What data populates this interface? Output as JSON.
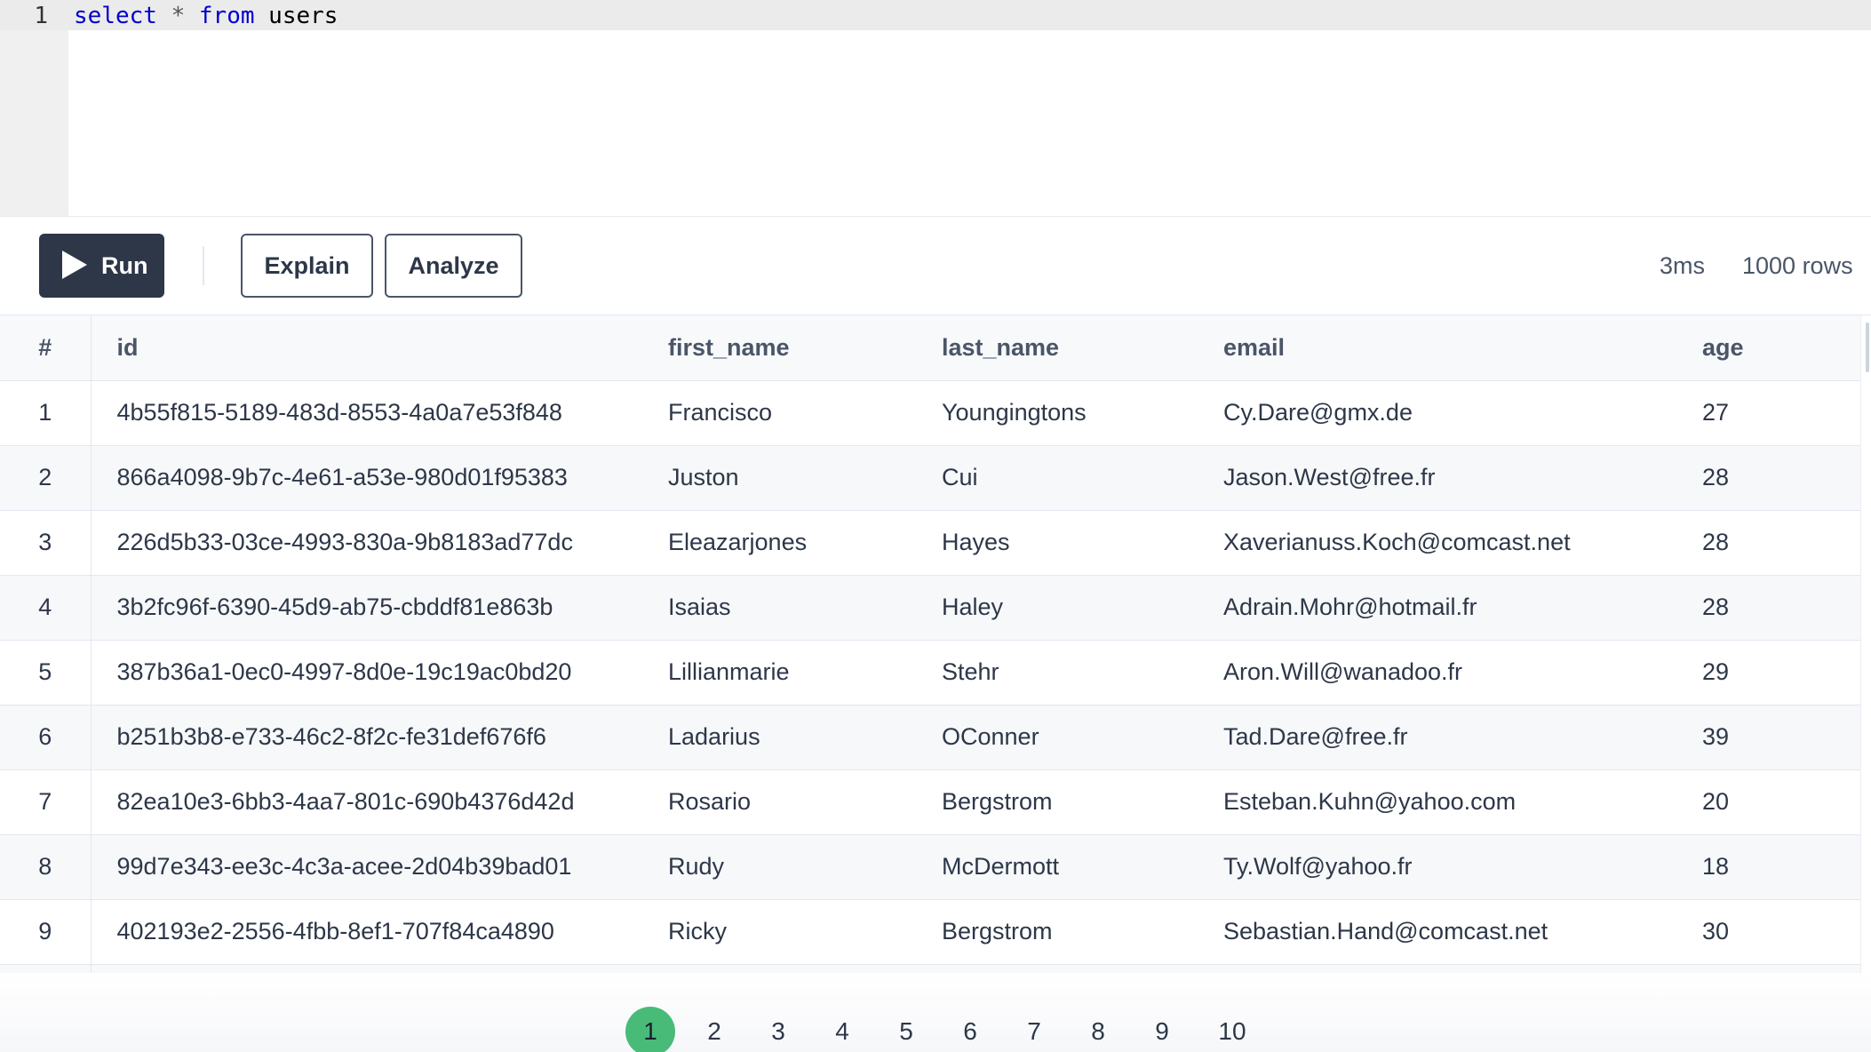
{
  "editor": {
    "line_number": "1",
    "query": {
      "kw1": "select",
      "op": "*",
      "kw2": "from",
      "ident": "users"
    }
  },
  "toolbar": {
    "run_label": "Run",
    "explain_label": "Explain",
    "analyze_label": "Analyze",
    "elapsed": "3ms",
    "row_count": "1000 rows"
  },
  "table": {
    "headers": [
      "#",
      "id",
      "first_name",
      "last_name",
      "email",
      "age"
    ],
    "rows": [
      [
        "1",
        "4b55f815-5189-483d-8553-4a0a7e53f848",
        "Francisco",
        "Youngingtons",
        "Cy.Dare@gmx.de",
        "27"
      ],
      [
        "2",
        "866a4098-9b7c-4e61-a53e-980d01f95383",
        "Juston",
        "Cui",
        "Jason.West@free.fr",
        "28"
      ],
      [
        "3",
        "226d5b33-03ce-4993-830a-9b8183ad77dc",
        "Eleazarjones",
        "Hayes",
        "Xaverianuss.Koch@comcast.net",
        "28"
      ],
      [
        "4",
        "3b2fc96f-6390-45d9-ab75-cbddf81e863b",
        "Isaias",
        "Haley",
        "Adrain.Mohr@hotmail.fr",
        "28"
      ],
      [
        "5",
        "387b36a1-0ec0-4997-8d0e-19c19ac0bd20",
        "Lillianmarie",
        "Stehr",
        "Aron.Will@wanadoo.fr",
        "29"
      ],
      [
        "6",
        "b251b3b8-e733-46c2-8f2c-fe31def676f6",
        "Ladarius",
        "OConner",
        "Tad.Dare@free.fr",
        "39"
      ],
      [
        "7",
        "82ea10e3-6bb3-4aa7-801c-690b4376d42d",
        "Rosario",
        "Bergstrom",
        "Esteban.Kuhn@yahoo.com",
        "20"
      ],
      [
        "8",
        "99d7e343-ee3c-4c3a-acee-2d04b39bad01",
        "Rudy",
        "McDermott",
        "Ty.Wolf@yahoo.fr",
        "18"
      ],
      [
        "9",
        "402193e2-2556-4fbb-8ef1-707f84ca4890",
        "Ricky",
        "Bergstrom",
        "Sebastian.Hand@comcast.net",
        "30"
      ],
      [
        "",
        "",
        "",
        "",
        "",
        ""
      ]
    ]
  },
  "pagination": {
    "pages": [
      "1",
      "2",
      "3",
      "4",
      "5",
      "6",
      "7",
      "8",
      "9",
      "10"
    ],
    "current": "1"
  },
  "colors": {
    "run_button": "#2d3748",
    "active_page": "#48bb78",
    "keyword": "#0000cc"
  },
  "icons": {
    "run": "play-icon"
  }
}
